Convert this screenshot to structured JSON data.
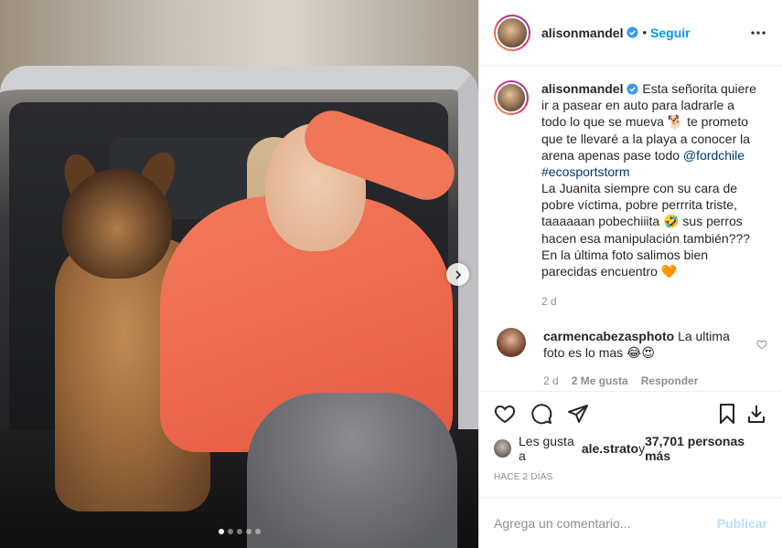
{
  "post": {
    "author": "alisonmandel",
    "separator": "•",
    "follow_label": "Seguir",
    "caption": {
      "text_1": "Esta señorita quiere ir a pasear en auto para ladrarle a todo lo que se mueva ",
      "emoji_1": "🐕",
      "text_2": " te prometo que te llevaré a la playa a conocer la arena apenas pase todo ",
      "mention": "@fordchile",
      "hashtag": "#ecosportstorm",
      "text_3": "La Juanita siempre con su cara de pobre víctima, pobre perrrita triste, taaaaaan pobechiiita ",
      "emoji_2": "🤣",
      "text_4": " sus perros hacen esa manipulación también??? En la última foto salimos bien parecidas encuentro ",
      "emoji_3": "🧡",
      "time": "2 d"
    },
    "comment": {
      "author": "carmencabezasphoto",
      "text": "La ultima foto es lo mas ",
      "emojis": "😂😍",
      "time": "2 d",
      "likes": "2 Me gusta",
      "reply": "Responder"
    },
    "likes": {
      "prefix": "Les gusta a ",
      "user": "ale.strato",
      "middle": " y ",
      "count": "37,701 personas más"
    },
    "date_label": "HACE 2 DÍAS",
    "comment_input": {
      "placeholder": "Agrega un comentario...",
      "publish_label": "Publicar"
    },
    "carousel": {
      "slides": 5,
      "active_index": 0
    }
  },
  "icons": {
    "verified": "verified-badge-icon",
    "more": "more-options-icon",
    "like": "heart-icon",
    "comment": "comment-icon",
    "share": "share-icon",
    "save": "bookmark-icon",
    "download": "download-icon",
    "next": "chevron-right-icon"
  },
  "colors": {
    "accent": "#0095f6",
    "muted": "#8e8e8e",
    "link": "#00376b",
    "sweater": "#ee6a4f"
  }
}
